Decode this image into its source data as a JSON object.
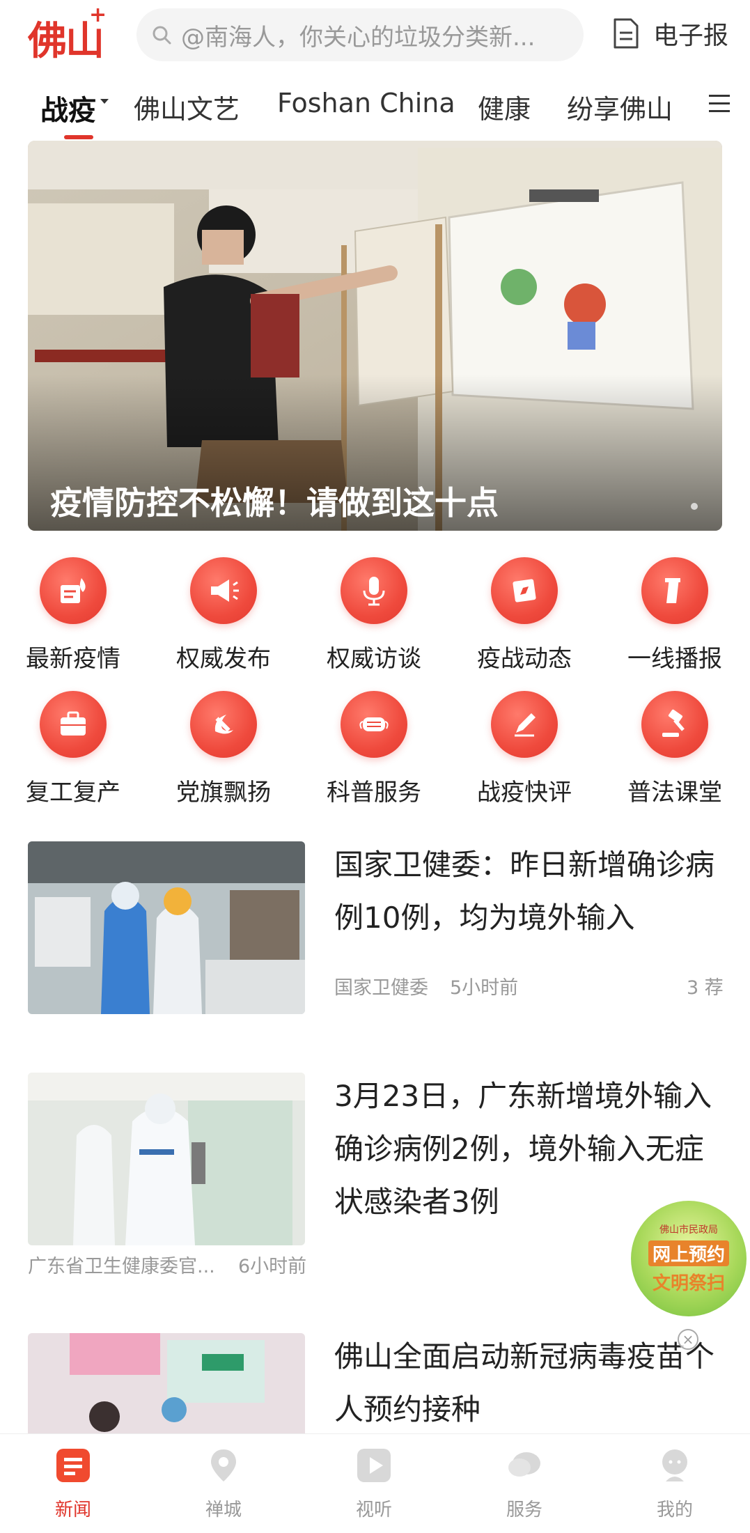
{
  "header": {
    "logo": "佛山",
    "logo_plus": "+",
    "search_placeholder": "@南海人，你关心的垃圾分类新...",
    "epaper_label": "电子报"
  },
  "tabs": [
    {
      "label": "战疫",
      "active": true
    },
    {
      "label": "佛山文艺"
    },
    {
      "label": "Foshan China"
    },
    {
      "label": "健康"
    },
    {
      "label": "纷享佛山"
    }
  ],
  "hero": {
    "caption": "疫情防控不松懈！请做到这十点"
  },
  "grid": [
    {
      "label": "最新疫情",
      "icon": "document-fire-icon"
    },
    {
      "label": "权威发布",
      "icon": "megaphone-icon"
    },
    {
      "label": "权威访谈",
      "icon": "microphone-icon"
    },
    {
      "label": "疫战动态",
      "icon": "compass-icon"
    },
    {
      "label": "一线播报",
      "icon": "number-one-icon"
    },
    {
      "label": "复工复产",
      "icon": "briefcase-icon"
    },
    {
      "label": "党旗飘扬",
      "icon": "hammer-sickle-icon"
    },
    {
      "label": "科普服务",
      "icon": "mask-icon"
    },
    {
      "label": "战疫快评",
      "icon": "pen-icon"
    },
    {
      "label": "普法课堂",
      "icon": "gavel-icon"
    }
  ],
  "news": [
    {
      "title": "国家卫健委：昨日新增确诊病例10例，均为境外输入",
      "source": "国家卫健委",
      "time": "5小时前",
      "recommend": "3 荐"
    },
    {
      "title": "3月23日，广东新增境外输入确诊病例2例，境外输入无症状感染者3例",
      "source": "广东省卫生健康委官...",
      "time": "6小时前"
    },
    {
      "title": "佛山全面启动新冠病毒疫苗个人预约接种"
    }
  ],
  "floating_badge": {
    "small": "佛山市民政局",
    "line1": "网上预约",
    "line2": "文明祭扫"
  },
  "bottom_nav": [
    {
      "label": "新闻",
      "active": true,
      "icon": "news-icon"
    },
    {
      "label": "禅城",
      "icon": "location-icon"
    },
    {
      "label": "视听",
      "icon": "play-icon"
    },
    {
      "label": "服务",
      "icon": "chat-icon"
    },
    {
      "label": "我的",
      "icon": "profile-icon"
    }
  ],
  "colors": {
    "brand_red": "#e0352b",
    "muted": "#999999"
  }
}
